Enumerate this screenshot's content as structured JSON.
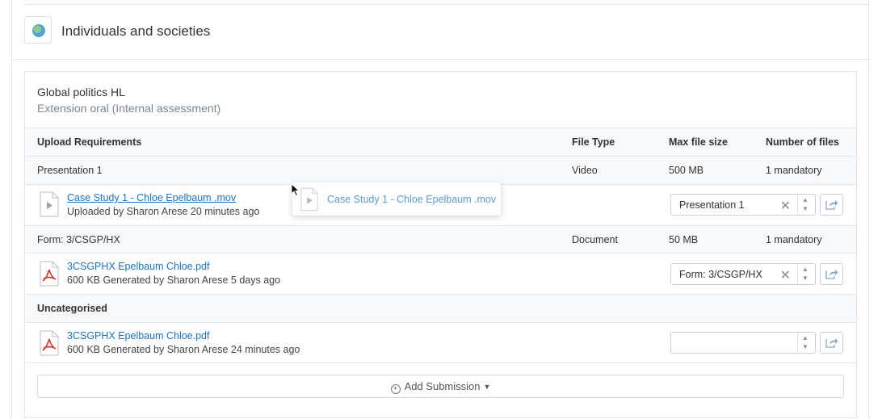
{
  "subject": {
    "title": "Individuals and societies",
    "icon": "globe-icon"
  },
  "course": {
    "title": "Global politics HL",
    "subtitle": "Extension oral (Internal assessment)"
  },
  "table_headers": {
    "requirements": "Upload Requirements",
    "file_type": "File Type",
    "max_size": "Max file size",
    "num_files": "Number of files"
  },
  "requirements": [
    {
      "name": "Presentation 1",
      "file_type": "Video",
      "max_size": "500 MB",
      "num_files": "1 mandatory",
      "file": {
        "name": "Case Study 1 - Chloe Epelbaum .mov",
        "meta": "Uploaded by Sharon Arese 20 minutes ago",
        "icon": "video-file-icon",
        "assigned": "Presentation 1"
      }
    },
    {
      "name": "Form: 3/CSGP/HX",
      "file_type": "Document",
      "max_size": "50 MB",
      "num_files": "1 mandatory",
      "file": {
        "name": "3CSGPHX Epelbaum Chloe.pdf",
        "meta": "600 KB Generated by Sharon Arese 5 days ago",
        "icon": "pdf-file-icon",
        "assigned": "Form: 3/CSGP/HX"
      }
    }
  ],
  "uncategorised": {
    "label": "Uncategorised",
    "file": {
      "name": "3CSGPHX Epelbaum Chloe.pdf",
      "meta": "600 KB Generated by Sharon Arese 24 minutes ago",
      "icon": "pdf-file-icon",
      "assigned": ""
    }
  },
  "add_submission_label": "Add Submission",
  "drag_ghost": {
    "name": "Case Study 1 - Chloe Epelbaum .mov"
  },
  "colors": {
    "link": "#1a73c8",
    "pdf": "#d9342b",
    "border": "#e3e6ea"
  }
}
